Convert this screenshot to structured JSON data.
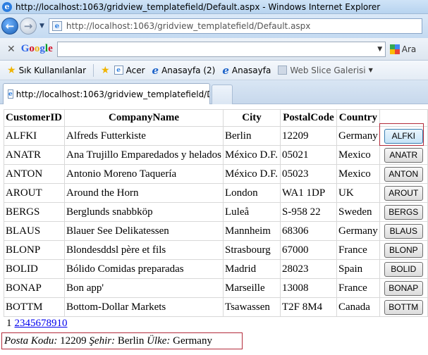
{
  "window": {
    "title": "http://localhost:1063/gridview_templatefield/Default.aspx - Windows Internet Explorer"
  },
  "address": {
    "url": "http://localhost:1063/gridview_templatefield/Default.aspx"
  },
  "google_toolbar": {
    "logo": "Google",
    "search_value": "",
    "search_button": "Ara"
  },
  "favorites": {
    "label": "Sık Kullanılanlar",
    "items": [
      {
        "label": "Acer"
      },
      {
        "label": "Anasayfa (2)"
      },
      {
        "label": "Anasayfa"
      },
      {
        "label": "Web Slice Galerisi"
      }
    ]
  },
  "tab": {
    "title": "http://localhost:1063/gridview_templatefield/Def..."
  },
  "grid": {
    "headers": [
      "CustomerID",
      "CompanyName",
      "City",
      "PostalCode",
      "Country"
    ],
    "rows": [
      {
        "id": "ALFKI",
        "company": "Alfreds Futterkiste",
        "city": "Berlin",
        "postal": "12209",
        "country": "Germany"
      },
      {
        "id": "ANATR",
        "company": "Ana Trujillo Emparedados y helados",
        "city": "México D.F.",
        "postal": "05021",
        "country": "Mexico"
      },
      {
        "id": "ANTON",
        "company": "Antonio Moreno Taquería",
        "city": "México D.F.",
        "postal": "05023",
        "country": "Mexico"
      },
      {
        "id": "AROUT",
        "company": "Around the Horn",
        "city": "London",
        "postal": "WA1 1DP",
        "country": "UK"
      },
      {
        "id": "BERGS",
        "company": "Berglunds snabbköp",
        "city": "Luleå",
        "postal": "S-958 22",
        "country": "Sweden"
      },
      {
        "id": "BLAUS",
        "company": "Blauer See Delikatessen",
        "city": "Mannheim",
        "postal": "68306",
        "country": "Germany"
      },
      {
        "id": "BLONP",
        "company": "Blondesddsl père et fils",
        "city": "Strasbourg",
        "postal": "67000",
        "country": "France"
      },
      {
        "id": "BOLID",
        "company": "Bólido Comidas preparadas",
        "city": "Madrid",
        "postal": "28023",
        "country": "Spain"
      },
      {
        "id": "BONAP",
        "company": "Bon app'",
        "city": "Marseille",
        "postal": "13008",
        "country": "France"
      },
      {
        "id": "BOTTM",
        "company": "Bottom-Dollar Markets",
        "city": "Tsawassen",
        "postal": "T2F 8M4",
        "country": "Canada"
      }
    ],
    "selected_row": 0
  },
  "pager": {
    "current": "1",
    "pages": [
      "2",
      "3",
      "4",
      "5",
      "6",
      "7",
      "8",
      "9",
      "10"
    ]
  },
  "details": {
    "postal_label": "Posta Kodu:",
    "postal_value": "12209",
    "city_label": "Şehir:",
    "city_value": "Berlin",
    "country_label": "Ülke:",
    "country_value": "Germany"
  },
  "colors": {
    "selection_border": "#b32b3b",
    "link": "#0000ee"
  }
}
